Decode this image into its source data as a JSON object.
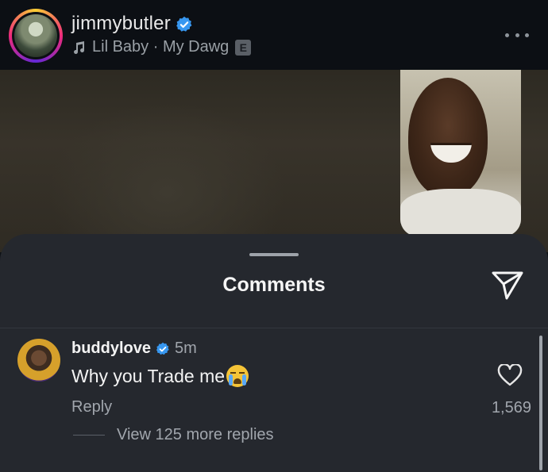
{
  "post": {
    "username": "jimmybutler",
    "song_artist": "Lil Baby",
    "song_separator": " · ",
    "song_title": "My Dawg",
    "explicit_badge": "E"
  },
  "sheet": {
    "title": "Comments"
  },
  "comment": {
    "username": "buddylove",
    "time": "5m",
    "text": "Why you Trade me",
    "emoji": "loudly-crying-face",
    "reply_label": "Reply",
    "like_count": "1,569",
    "view_replies_label": "View 125 more replies"
  },
  "colors": {
    "verified": "#3797f0",
    "sheet_bg": "#25282e",
    "secondary_text": "#a1a6ad"
  }
}
